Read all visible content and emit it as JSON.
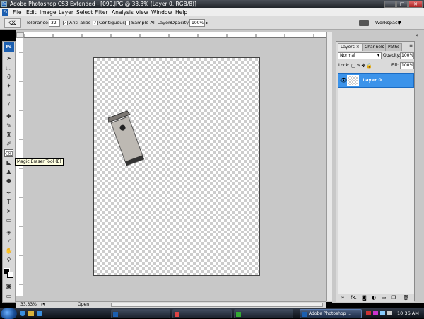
{
  "window": {
    "title": "Adobe Photoshop CS3 Extended - [099.JPG @ 33.3% (Layer 0, RGB/8)]",
    "app_icon": "Ps",
    "min_glyph": "─",
    "max_glyph": "□",
    "close_glyph": "✕"
  },
  "menubar": {
    "logo": "Ps",
    "items": [
      "File",
      "Edit",
      "Image",
      "Layer",
      "Select",
      "Filter",
      "Analysis",
      "View",
      "Window",
      "Help"
    ]
  },
  "options": {
    "tolerance_label": "Tolerance:",
    "tolerance_value": "32",
    "antialias_label": "Anti-alias",
    "contiguous_label": "Contiguous",
    "sample_all_label": "Sample All Layers",
    "opacity_label": "Opacity:",
    "opacity_value": "100%",
    "workspace_label": "Workspace",
    "checked_glyph": "✓"
  },
  "toolbox": {
    "logo": "Ps",
    "tooltip": "Magic Eraser Tool (E)"
  },
  "status": {
    "zoom": "33.33%",
    "doc_label": "Open"
  },
  "layers_panel": {
    "tabs": [
      "Layers",
      "Channels",
      "Paths"
    ],
    "blend_mode": "Normal",
    "opacity_label": "Opacity:",
    "opacity_value": "100%",
    "lock_label": "Lock:",
    "fill_label": "Fill:",
    "fill_value": "100%",
    "layer_name": "Layer 0",
    "footer_fx": "fx."
  },
  "taskbar": {
    "active_app": "Adobe Photoshop ...",
    "clock": "10:36 AM"
  },
  "colors": {
    "accent": "#3b93ea",
    "ps_blue": "#1c5fb0"
  }
}
